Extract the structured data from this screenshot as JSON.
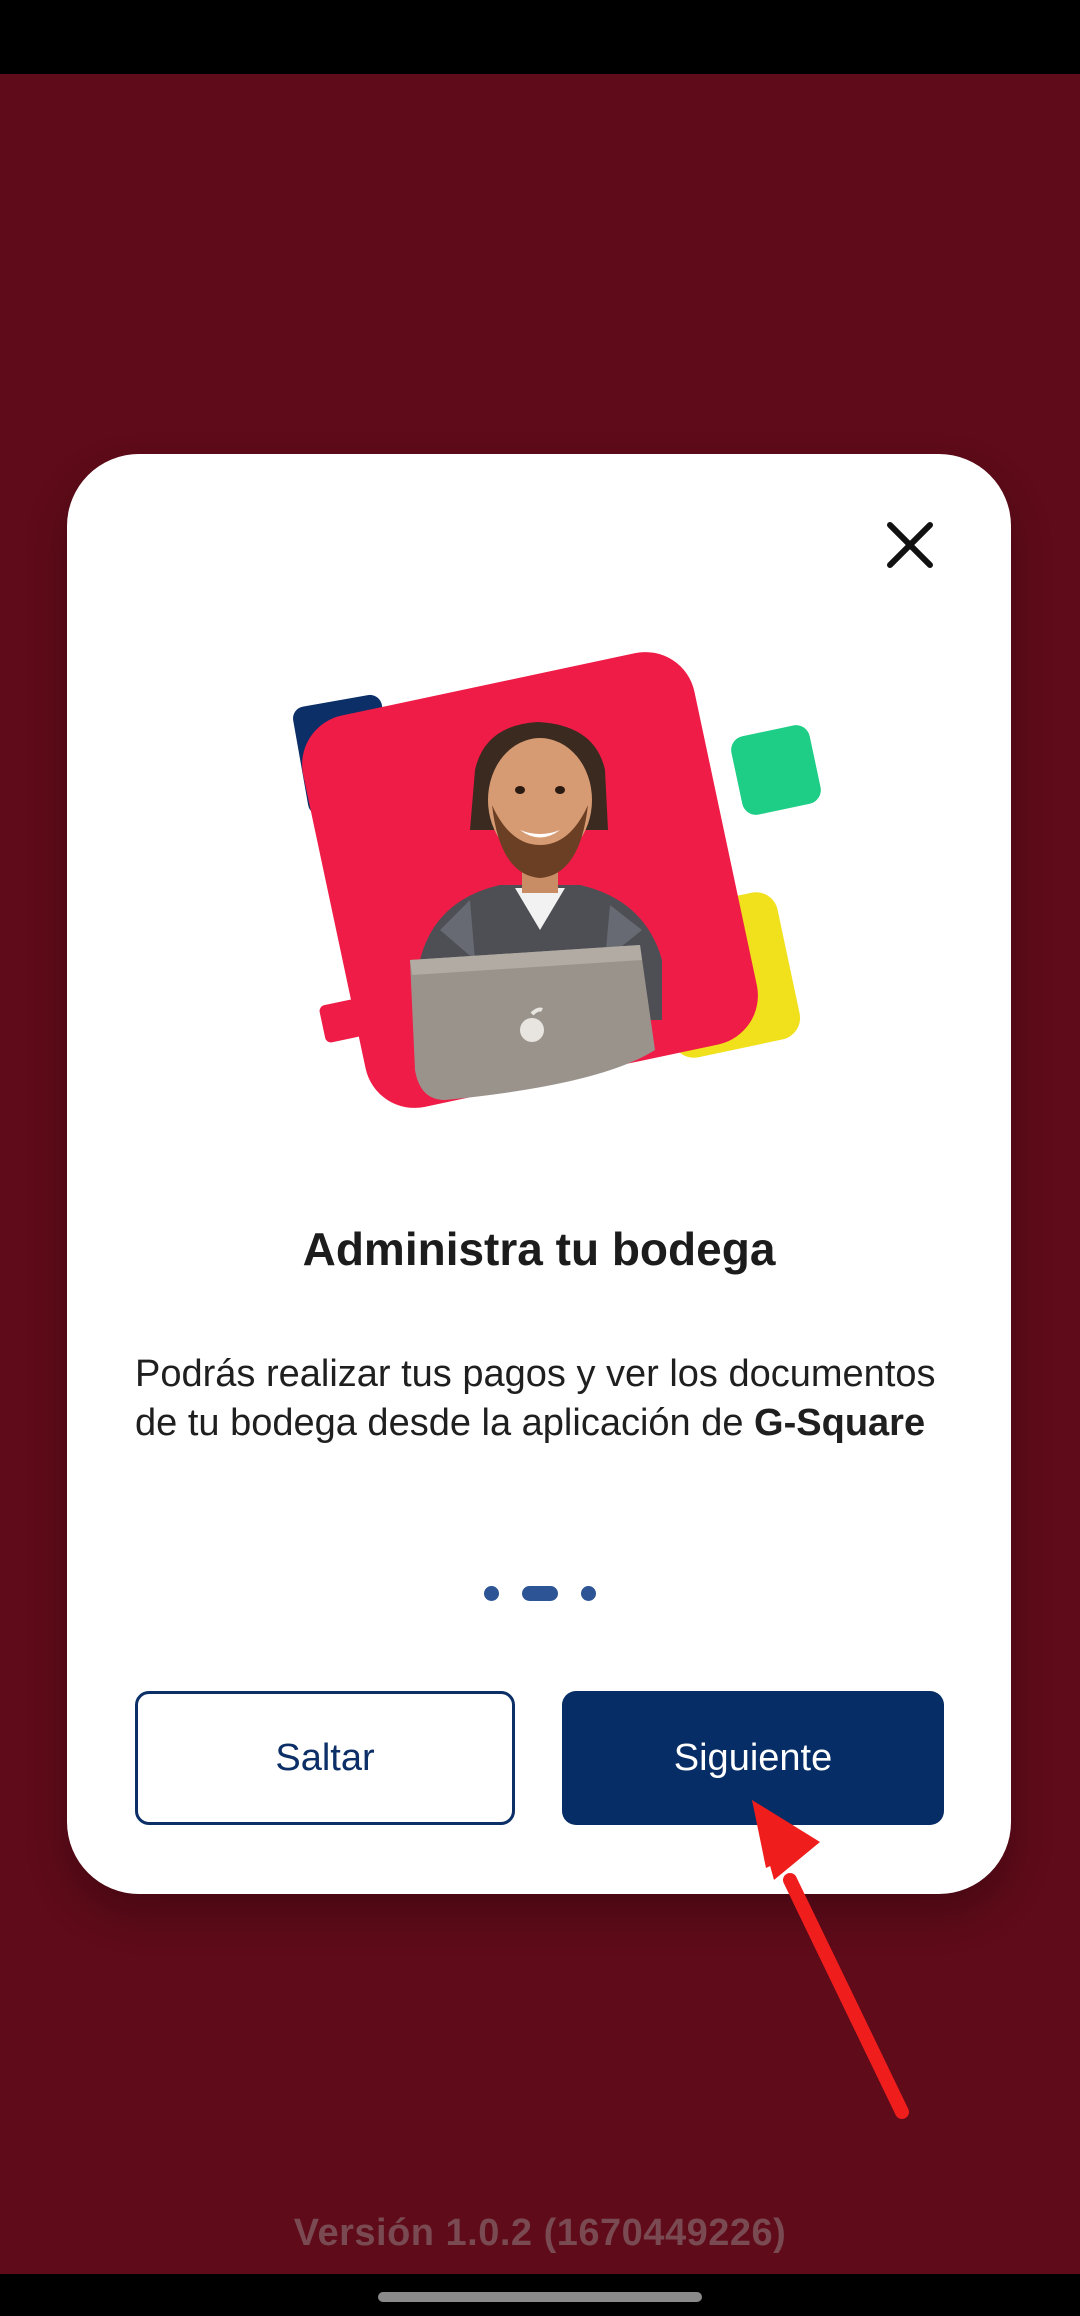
{
  "onboarding": {
    "title": "Administra tu bodega",
    "description_prefix": "Podrás realizar tus pagos y ver los documentos de tu bodega desde la aplicación de ",
    "description_brand": "G-Square",
    "pager": {
      "total": 3,
      "active_index": 1
    },
    "buttons": {
      "skip_label": "Saltar",
      "next_label": "Siguiente"
    },
    "close_icon": "close-icon"
  },
  "footer": {
    "version": "Versión 1.0.2 (1670449226)"
  },
  "colors": {
    "background": "#5f0b19",
    "primary": "#072d66",
    "accent_red": "#ef1c47",
    "accent_yellow": "#f1e01c",
    "accent_green": "#1ece86",
    "accent_navy": "#0b2f66",
    "annotation_arrow": "#f01d1d"
  }
}
